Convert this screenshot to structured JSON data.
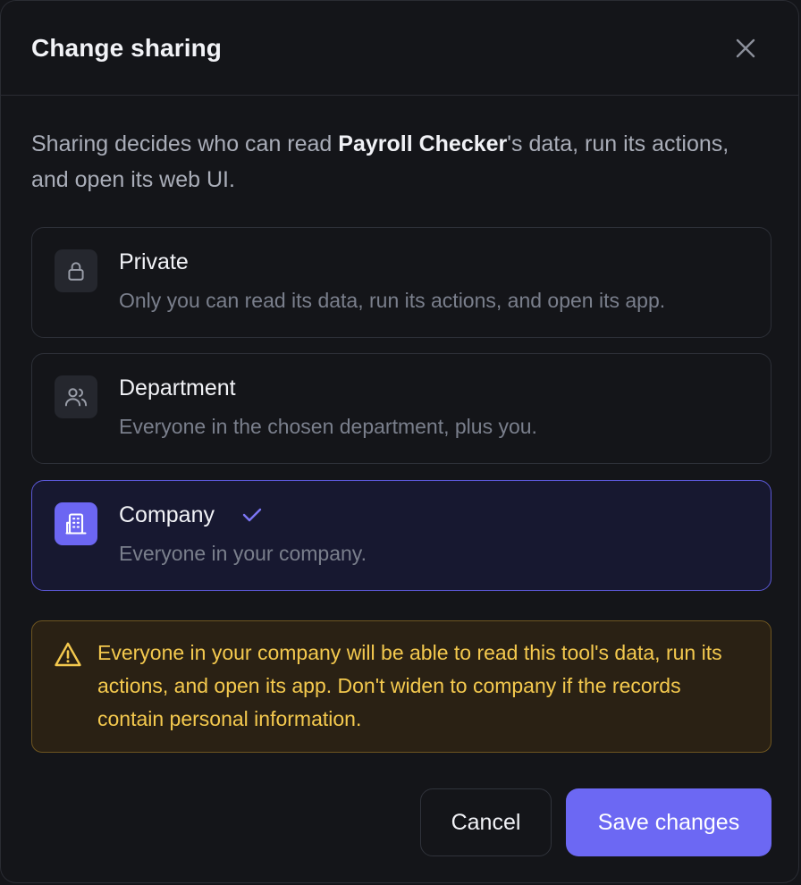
{
  "dialog": {
    "title": "Change sharing",
    "description": {
      "before": "Sharing decides who can read ",
      "tool_name": "Payroll Checker",
      "after": "'s data, run its actions, and open its web UI."
    }
  },
  "options": [
    {
      "title": "Private",
      "description": "Only you can read its data, run its actions, and open its app.",
      "icon": "lock-icon",
      "selected": false
    },
    {
      "title": "Department",
      "description": "Everyone in the chosen department, plus you.",
      "icon": "users-icon",
      "selected": false
    },
    {
      "title": "Company",
      "description": "Everyone in your company.",
      "icon": "building-icon",
      "selected": true
    }
  ],
  "warning": {
    "text": "Everyone in your company will be able to read this tool's data, run its actions, and open its app. Don't widen to company if the records contain personal information.",
    "icon": "warning-icon"
  },
  "buttons": {
    "cancel": "Cancel",
    "save": "Save changes"
  },
  "colors": {
    "accent": "#6c68f3",
    "warning_text": "#f4c94e",
    "warning_bg": "#2a2114"
  }
}
